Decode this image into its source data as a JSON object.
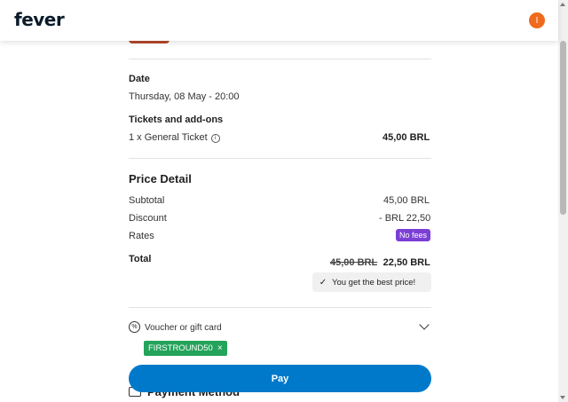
{
  "header": {
    "logo": "fever",
    "avatar_initial": "I"
  },
  "date": {
    "label": "Date",
    "value": "Thursday, 08 May - 20:00"
  },
  "tickets": {
    "label": "Tickets and add-ons",
    "item": "1 x General Ticket",
    "price": "45,00 BRL"
  },
  "price_detail": {
    "title": "Price Detail",
    "subtotal_label": "Subtotal",
    "subtotal_value": "45,00 BRL",
    "discount_label": "Discount",
    "discount_value": "- BRL 22,50",
    "rates_label": "Rates",
    "rates_badge": "No fees",
    "total_label": "Total",
    "total_old": "45,00 BRL",
    "total_new": "22,50 BRL",
    "best_price": "You get the best price!"
  },
  "voucher": {
    "label": "Voucher or gift card",
    "code": "FIRSTROUND50"
  },
  "pay_button": "Pay",
  "payment_method": "Payment Method",
  "colors": {
    "accent": "#0079ca",
    "badge": "#7b3fd6",
    "chip": "#24a35a",
    "avatar": "#f06a1d"
  }
}
